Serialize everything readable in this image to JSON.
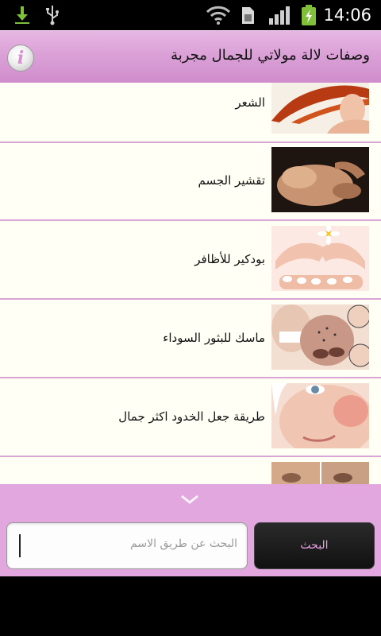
{
  "status_bar": {
    "time": "14:06",
    "icons": [
      "download-icon",
      "usb-icon",
      "wifi-icon",
      "sim-icon",
      "signal-icon",
      "battery-charging-icon"
    ]
  },
  "header": {
    "title": "وصفات لالة مولاتي للجمال مجربة",
    "info_icon": "info-icon"
  },
  "list": {
    "items": [
      {
        "label": "الشعر"
      },
      {
        "label": "تقشير الجسم"
      },
      {
        "label": "بودكير للأظافر"
      },
      {
        "label": "ماسك للبثور السوداء"
      },
      {
        "label": "طريقة جعل الخدود اكثر جمال"
      },
      {
        "label": ""
      }
    ]
  },
  "search": {
    "placeholder": "البحث عن طريق الاسم",
    "button_label": "البحث"
  },
  "colors": {
    "accent": "#dca3d8",
    "divider": "#d9a5d6",
    "list_bg": "#fffff5"
  }
}
